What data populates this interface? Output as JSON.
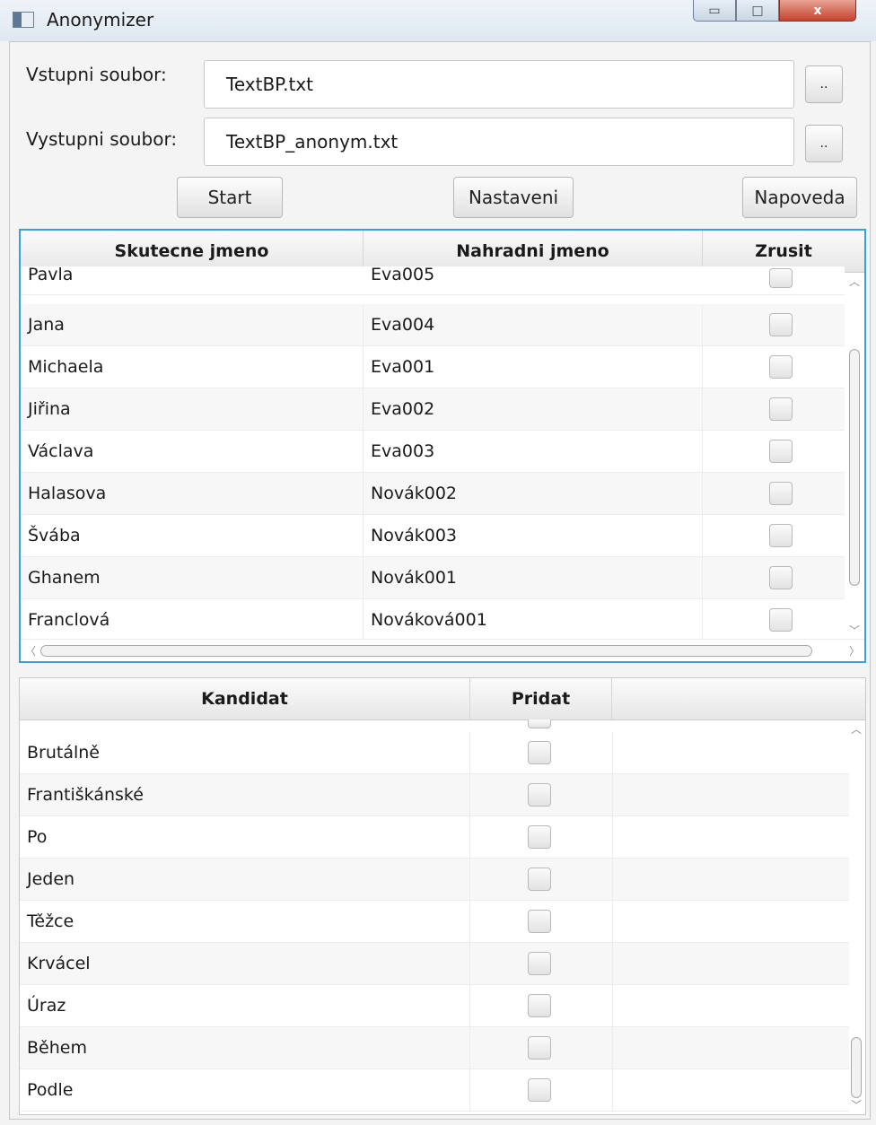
{
  "window": {
    "title": "Anonymizer",
    "controls": {
      "minimize": "▭",
      "maximize": "□",
      "close": "x"
    }
  },
  "form": {
    "input_label": "Vstupni soubor:",
    "input_value": "TextBP.txt",
    "output_label": "Vystupni soubor:",
    "output_value": "TextBP_anonym.txt",
    "browse_label": ".."
  },
  "actions": {
    "start": "Start",
    "settings": "Nastaveni",
    "help": "Napoveda"
  },
  "names_table": {
    "columns": [
      "Skutecne jmeno",
      "Nahradni jmeno",
      "Zrusit"
    ],
    "rows": [
      {
        "real": "Pavla",
        "replacement": "Eva005"
      },
      {
        "real": "Jana",
        "replacement": "Eva004"
      },
      {
        "real": "Michaela",
        "replacement": "Eva001"
      },
      {
        "real": "Jiřina",
        "replacement": "Eva002"
      },
      {
        "real": "Václava",
        "replacement": "Eva003"
      },
      {
        "real": "Halasova",
        "replacement": "Novák002"
      },
      {
        "real": "Švába",
        "replacement": "Novák003"
      },
      {
        "real": "Ghanem",
        "replacement": "Novák001"
      },
      {
        "real": "Franclová",
        "replacement": "Nováková001"
      }
    ]
  },
  "candidates_table": {
    "columns": [
      "Kandidat",
      "Pridat",
      ""
    ],
    "rows": [
      "Brutálně",
      "Františkánské",
      "Po",
      "Jeden",
      "Těžce",
      "Krvácel",
      "Úraz",
      "Během",
      "Podle"
    ]
  }
}
